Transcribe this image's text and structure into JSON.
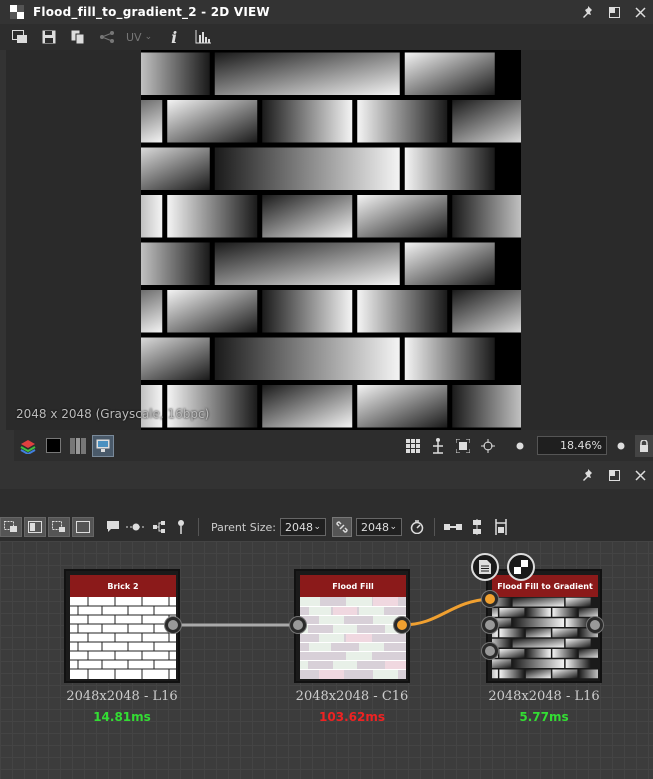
{
  "view": {
    "title": "Flood_fill_to_gradient_2 - 2D VIEW",
    "resolution_label": "2048 x 2048 (Grayscale, 16bpc)",
    "uv_label": "UV",
    "zoom": "18.46%"
  },
  "graph": {
    "parent_size_label": "Parent Size:",
    "parent_size_value": "2048",
    "size_value": "2048",
    "nodes": [
      {
        "title": "Brick 2",
        "size": "2048x2048 - L16",
        "time": "14.81ms",
        "time_color": "#33dd33"
      },
      {
        "title": "Flood Fill",
        "size": "2048x2048 - C16",
        "time": "103.62ms",
        "time_color": "#ee2222"
      },
      {
        "title": "Flood Fill to Gradient",
        "size": "2048x2048 - L16",
        "time": "5.77ms",
        "time_color": "#33dd33"
      }
    ]
  },
  "icons": {
    "title": "grid-window-icon",
    "pin": "pin-icon",
    "maximize": "maximize-icon",
    "close": "close-icon"
  }
}
